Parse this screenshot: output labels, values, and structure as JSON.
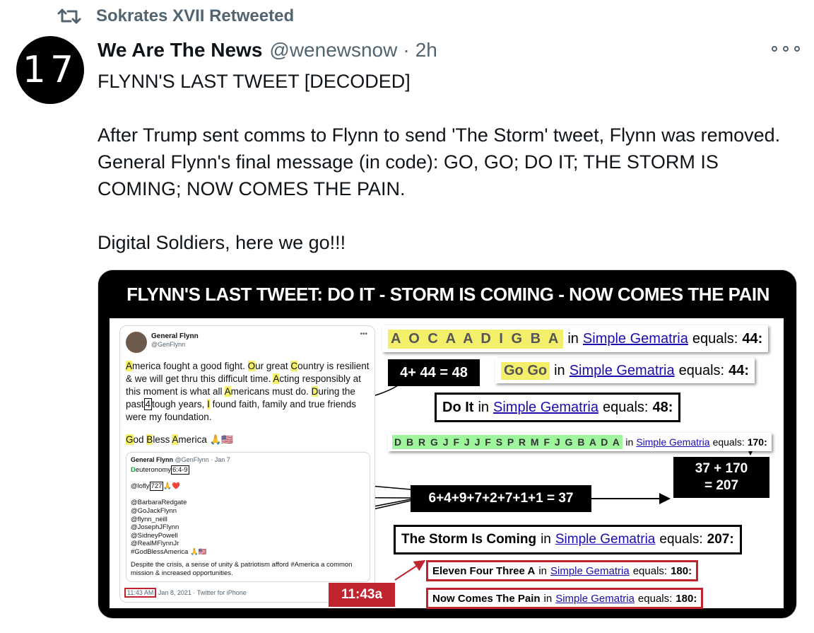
{
  "retweet": {
    "label": "Sokrates XVII Retweeted"
  },
  "author": {
    "avatar_text": "17",
    "name": "We Are The News",
    "handle": "@wenewsnow",
    "separator": "·",
    "time": "2h"
  },
  "tweet": {
    "line1": "FLYNN'S LAST TWEET [DECODED]",
    "para2": "After Trump sent comms to Flynn to send 'The Storm' tweet, Flynn was removed. General Flynn's final message (in code): GO, GO; DO IT; THE STORM IS COMING; NOW COMES THE PAIN.",
    "para3": "Digital Soldiers, here we go!!!"
  },
  "image": {
    "banner": "FLYNN'S LAST TWEET:  DO IT - STORM IS COMING - NOW COMES THE PAIN",
    "card": {
      "name": "General Flynn",
      "handle": "@GenFlynn",
      "more": "•••",
      "text": {
        "a1": "A",
        "t1": "merica fought a good fight. ",
        "a2": "O",
        "t2": "ur great ",
        "a3": "C",
        "t3": "ountry is resilient & we will get thru this difficult time. ",
        "a4": "A",
        "t4": "cting responsibly at this moment is what all ",
        "a5": "A",
        "t5": "mericans must do. ",
        "a6": "D",
        "t6": "uring the past",
        "box": "4",
        "t7": "tough years, ",
        "a7": "I",
        "t8": " found faith, family and true friends were my foundation."
      },
      "godbless": {
        "g": "G",
        "t1": "od ",
        "b": "B",
        "t2": "less ",
        "a": "A",
        "t3": "merica 🙏🇺🇸"
      },
      "quote": {
        "name": "General Flynn",
        "meta": "@GenFlynn · Jan 7",
        "l1a": "D",
        "l1b": "euteronomy",
        "l1box": "6:4-9",
        "l2a": "@lofly",
        "l2box": "727",
        "l2c": "🙏❤️",
        "l3": "@BarbaraRedgate",
        "l4": "@GoJackFlynn",
        "l5": "@flynn_neill",
        "l6": "@JosephJFlynn",
        "l7": "@SidneyPowell",
        "l8": "@RealMFlynnJr",
        "l9": "#GodBlessAmerica 🙏🇺🇸",
        "foot": "Despite the crisis, a sense of unity & patriotism afford #America a common mission & increased opportunities."
      },
      "time_box": "11:43 AM",
      "time_rest": "Jan 8, 2021 · Twitter for iPhone"
    },
    "rows": {
      "r1_code": "A O C A A D I G B A",
      "r1_in": "in",
      "r1_link": "Simple Gematria",
      "r1_eq": "equals:",
      "r1_val": "44:",
      "sum1": "4+ 44 = 48",
      "r2_code": "Go Go",
      "r2_in": "in",
      "r2_link": "Simple Gematria",
      "r2_eq": "equals:",
      "r2_val": "44:",
      "r3_code": "Do It",
      "r3_in": "in",
      "r3_link": "Simple Gematria",
      "r3_eq": "equals:",
      "r3_val": "48:",
      "r4_code": "D B R G J F J J F S P R M F J G B A D A",
      "r4_in": "in",
      "r4_link": "Simple Gematria",
      "r4_eq": "equals:",
      "r4_val": "170:",
      "sum2": "6+4+9+7+2+7+1+1 = 37",
      "sum3a": "37 + 170",
      "sum3b": "= 207",
      "r5_code": "The Storm Is Coming",
      "r5_in": "in",
      "r5_link": "Simple Gematria",
      "r5_eq": "equals:",
      "r5_val": "207:",
      "r6_code": "Eleven Four Three A",
      "r6_in": "in",
      "r6_link": "Simple Gematria",
      "r6_eq": "equals:",
      "r6_val": "180:",
      "r7_code": "Now Comes The Pain",
      "r7_in": "in",
      "r7_link": "Simple Gematria",
      "r7_eq": "equals:",
      "r7_val": "180:",
      "time_tag": "11:43a"
    }
  },
  "colors": {
    "accent_red": "#c0242f",
    "highlight_yellow": "#f4ef6a",
    "highlight_green": "#9ef59e",
    "link_blue": "#1a0dab",
    "muted": "#536471"
  }
}
